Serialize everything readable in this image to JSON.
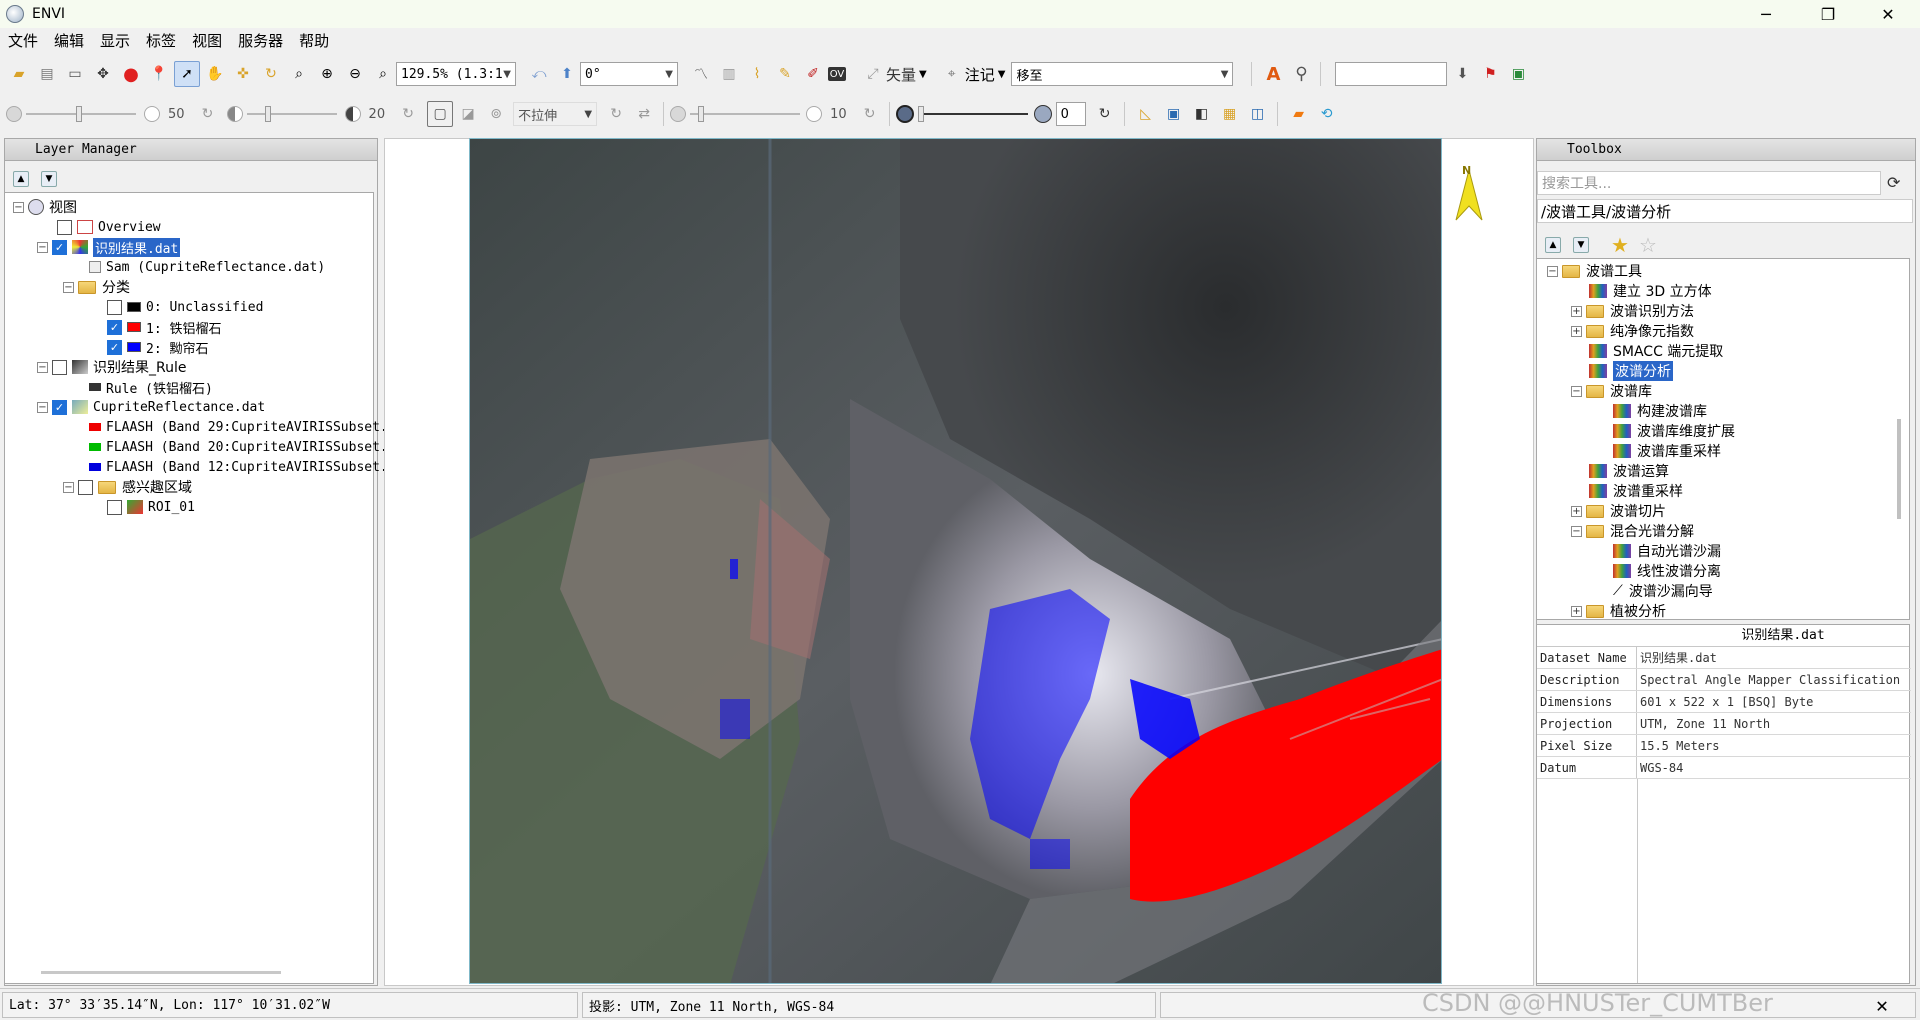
{
  "window": {
    "title": "ENVI",
    "min": "─",
    "max": "❐",
    "close": "✕"
  },
  "menu": [
    "文件",
    "编辑",
    "显示",
    "标签",
    "视图",
    "服务器",
    "帮助"
  ],
  "toolbar1": {
    "zoom_value": "129.5% (1.3:1",
    "rotation_value": "0°",
    "vector_label": "矢量",
    "annotation_label": "注记",
    "goto_value": "移至",
    "search_value": ""
  },
  "toolbar2": {
    "brightness_value": "50",
    "contrast_value": "20",
    "stretch_value": "不拉伸",
    "sharpen_value": "10",
    "transparency_value": "0"
  },
  "layer_manager": {
    "title": "Layer Manager",
    "items": [
      {
        "label": "视图"
      },
      {
        "label": "Overview"
      },
      {
        "label": "识别结果.dat"
      },
      {
        "label": "Sam (CupriteReflectance.dat)"
      },
      {
        "label": "分类"
      },
      {
        "label": "0: Unclassified"
      },
      {
        "label": "1: 铁铝榴石"
      },
      {
        "label": "2: 黝帘石"
      },
      {
        "label": "识别结果_Rule"
      },
      {
        "label": "Rule (铁铝榴石)"
      },
      {
        "label": "CupriteReflectance.dat"
      },
      {
        "label": "FLAASH (Band 29:CupriteAVIRISSubset."
      },
      {
        "label": "FLAASH (Band 20:CupriteAVIRISSubset."
      },
      {
        "label": "FLAASH (Band 12:CupriteAVIRISSubset."
      },
      {
        "label": "感兴趣区域"
      },
      {
        "label": "ROI_01"
      }
    ]
  },
  "toolbox": {
    "title": "Toolbox",
    "search_placeholder": "搜索工具...",
    "path": "/波谱工具/波谱分析",
    "items": [
      {
        "label": "波谱工具"
      },
      {
        "label": "建立 3D 立方体"
      },
      {
        "label": "波谱识别方法"
      },
      {
        "label": "纯净像元指数"
      },
      {
        "label": "SMACC 端元提取"
      },
      {
        "label": "波谱分析"
      },
      {
        "label": "波谱库"
      },
      {
        "label": "构建波谱库"
      },
      {
        "label": "波谱库维度扩展"
      },
      {
        "label": "波谱库重采样"
      },
      {
        "label": "波谱运算"
      },
      {
        "label": "波谱重采样"
      },
      {
        "label": "波谱切片"
      },
      {
        "label": "混合光谱分解"
      },
      {
        "label": "自动光谱沙漏"
      },
      {
        "label": "线性波谱分离"
      },
      {
        "label": "波谱沙漏向导"
      },
      {
        "label": "植被分析"
      }
    ]
  },
  "properties": {
    "header": "识别结果.dat",
    "rows": [
      {
        "key": "Dataset Name",
        "value": "识别结果.dat"
      },
      {
        "key": "Description",
        "value": "Spectral Angle Mapper Classification"
      },
      {
        "key": "Dimensions",
        "value": "601 x 522 x 1 [BSQ] Byte"
      },
      {
        "key": "Projection",
        "value": "UTM, Zone 11 North"
      },
      {
        "key": "Pixel Size",
        "value": "15.5 Meters"
      },
      {
        "key": "Datum",
        "value": "WGS-84"
      }
    ]
  },
  "north_arrow": "N",
  "status": {
    "coords": "Lat: 37° 33′35.14″N, Lon: 117° 10′31.02″W",
    "projection": "投影:  UTM, Zone 11 North, WGS-84"
  },
  "watermark": "CSDN @@HNUSTer_CUMTBer",
  "colors": {
    "class1": "#ff0000",
    "class2": "#0000ff",
    "selection": "#2a66c8"
  }
}
